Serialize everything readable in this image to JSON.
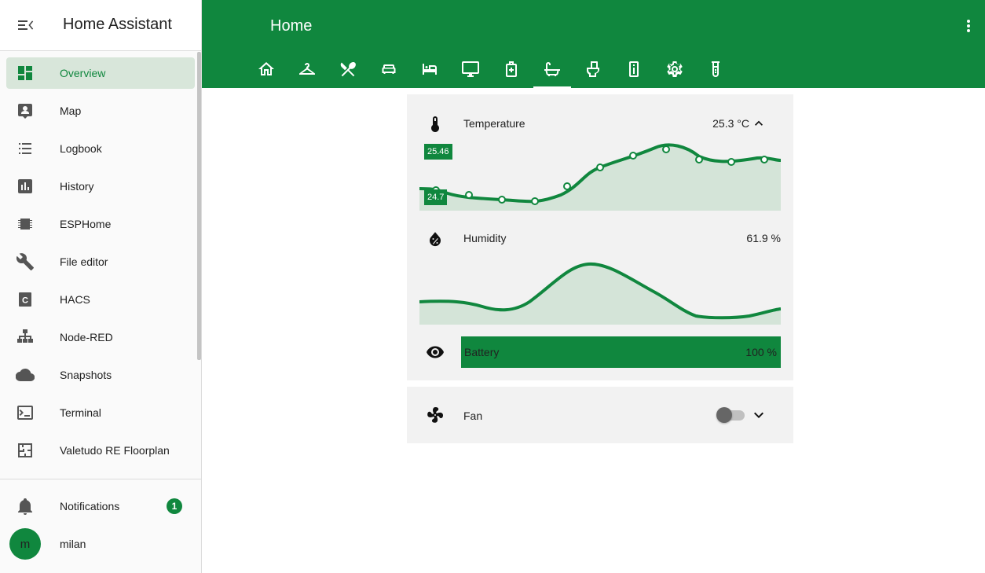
{
  "app": {
    "title": "Home Assistant"
  },
  "sidebar": {
    "items": [
      {
        "label": "Overview",
        "icon": "view-dashboard-icon",
        "active": true
      },
      {
        "label": "Map",
        "icon": "account-box-icon"
      },
      {
        "label": "Logbook",
        "icon": "format-list-bulleted-icon"
      },
      {
        "label": "History",
        "icon": "chart-box-icon"
      },
      {
        "label": "ESPHome",
        "icon": "chip-icon"
      },
      {
        "label": "File editor",
        "icon": "wrench-icon"
      },
      {
        "label": "HACS",
        "icon": "hacs-icon"
      },
      {
        "label": "Node-RED",
        "icon": "sitemap-icon"
      },
      {
        "label": "Snapshots",
        "icon": "cloud-icon"
      },
      {
        "label": "Terminal",
        "icon": "console-icon"
      },
      {
        "label": "Valetudo RE Floorplan",
        "icon": "floor-plan-icon"
      }
    ],
    "notifications": {
      "label": "Notifications",
      "count": "1"
    },
    "user": {
      "name": "milan",
      "initial": "m"
    }
  },
  "header": {
    "title": "Home",
    "tabs": [
      {
        "icon": "home-icon"
      },
      {
        "icon": "hanger-icon"
      },
      {
        "icon": "silverware-icon"
      },
      {
        "icon": "sofa-icon"
      },
      {
        "icon": "bed-icon"
      },
      {
        "icon": "monitor-icon"
      },
      {
        "icon": "bag-icon"
      },
      {
        "icon": "bathtub-icon",
        "active": true
      },
      {
        "icon": "toilet-icon"
      },
      {
        "icon": "remote-icon"
      },
      {
        "icon": "cog-icon"
      },
      {
        "icon": "test-tube-icon"
      }
    ]
  },
  "cards": {
    "temperature": {
      "name": "Temperature",
      "value": "25.3 °C",
      "max_label": "25.46",
      "min_label": "24.7"
    },
    "humidity": {
      "name": "Humidity",
      "value": "61.9 %"
    },
    "battery": {
      "name": "Battery",
      "value": "100 %",
      "level": 1.0
    },
    "fan": {
      "name": "Fan",
      "state": "off"
    }
  },
  "colors": {
    "accent": "#10873e",
    "fill": "#d4e4d8",
    "card_bg": "#f2f2f2"
  }
}
